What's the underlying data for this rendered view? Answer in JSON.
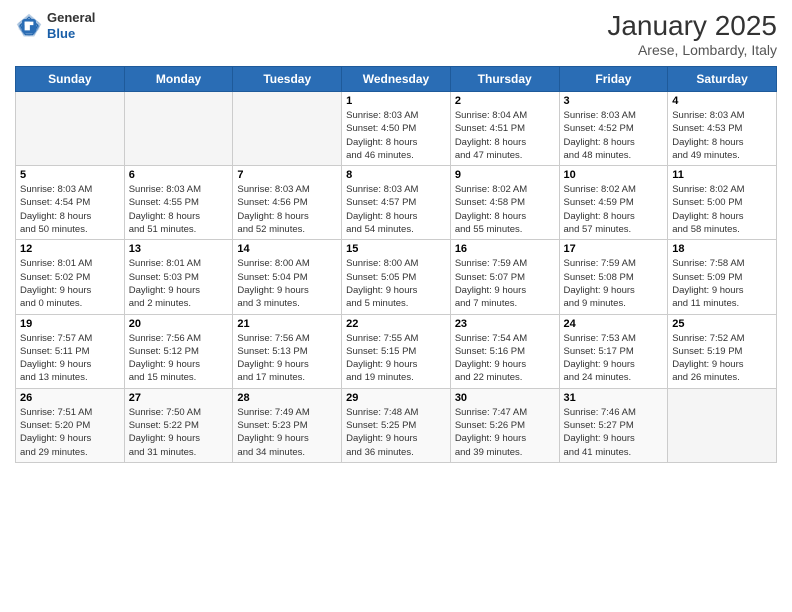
{
  "header": {
    "logo_general": "General",
    "logo_blue": "Blue",
    "month_title": "January 2025",
    "location": "Arese, Lombardy, Italy"
  },
  "weekdays": [
    "Sunday",
    "Monday",
    "Tuesday",
    "Wednesday",
    "Thursday",
    "Friday",
    "Saturday"
  ],
  "weeks": [
    [
      {
        "day": "",
        "info": ""
      },
      {
        "day": "",
        "info": ""
      },
      {
        "day": "",
        "info": ""
      },
      {
        "day": "1",
        "info": "Sunrise: 8:03 AM\nSunset: 4:50 PM\nDaylight: 8 hours\nand 46 minutes."
      },
      {
        "day": "2",
        "info": "Sunrise: 8:04 AM\nSunset: 4:51 PM\nDaylight: 8 hours\nand 47 minutes."
      },
      {
        "day": "3",
        "info": "Sunrise: 8:03 AM\nSunset: 4:52 PM\nDaylight: 8 hours\nand 48 minutes."
      },
      {
        "day": "4",
        "info": "Sunrise: 8:03 AM\nSunset: 4:53 PM\nDaylight: 8 hours\nand 49 minutes."
      }
    ],
    [
      {
        "day": "5",
        "info": "Sunrise: 8:03 AM\nSunset: 4:54 PM\nDaylight: 8 hours\nand 50 minutes."
      },
      {
        "day": "6",
        "info": "Sunrise: 8:03 AM\nSunset: 4:55 PM\nDaylight: 8 hours\nand 51 minutes."
      },
      {
        "day": "7",
        "info": "Sunrise: 8:03 AM\nSunset: 4:56 PM\nDaylight: 8 hours\nand 52 minutes."
      },
      {
        "day": "8",
        "info": "Sunrise: 8:03 AM\nSunset: 4:57 PM\nDaylight: 8 hours\nand 54 minutes."
      },
      {
        "day": "9",
        "info": "Sunrise: 8:02 AM\nSunset: 4:58 PM\nDaylight: 8 hours\nand 55 minutes."
      },
      {
        "day": "10",
        "info": "Sunrise: 8:02 AM\nSunset: 4:59 PM\nDaylight: 8 hours\nand 57 minutes."
      },
      {
        "day": "11",
        "info": "Sunrise: 8:02 AM\nSunset: 5:00 PM\nDaylight: 8 hours\nand 58 minutes."
      }
    ],
    [
      {
        "day": "12",
        "info": "Sunrise: 8:01 AM\nSunset: 5:02 PM\nDaylight: 9 hours\nand 0 minutes."
      },
      {
        "day": "13",
        "info": "Sunrise: 8:01 AM\nSunset: 5:03 PM\nDaylight: 9 hours\nand 2 minutes."
      },
      {
        "day": "14",
        "info": "Sunrise: 8:00 AM\nSunset: 5:04 PM\nDaylight: 9 hours\nand 3 minutes."
      },
      {
        "day": "15",
        "info": "Sunrise: 8:00 AM\nSunset: 5:05 PM\nDaylight: 9 hours\nand 5 minutes."
      },
      {
        "day": "16",
        "info": "Sunrise: 7:59 AM\nSunset: 5:07 PM\nDaylight: 9 hours\nand 7 minutes."
      },
      {
        "day": "17",
        "info": "Sunrise: 7:59 AM\nSunset: 5:08 PM\nDaylight: 9 hours\nand 9 minutes."
      },
      {
        "day": "18",
        "info": "Sunrise: 7:58 AM\nSunset: 5:09 PM\nDaylight: 9 hours\nand 11 minutes."
      }
    ],
    [
      {
        "day": "19",
        "info": "Sunrise: 7:57 AM\nSunset: 5:11 PM\nDaylight: 9 hours\nand 13 minutes."
      },
      {
        "day": "20",
        "info": "Sunrise: 7:56 AM\nSunset: 5:12 PM\nDaylight: 9 hours\nand 15 minutes."
      },
      {
        "day": "21",
        "info": "Sunrise: 7:56 AM\nSunset: 5:13 PM\nDaylight: 9 hours\nand 17 minutes."
      },
      {
        "day": "22",
        "info": "Sunrise: 7:55 AM\nSunset: 5:15 PM\nDaylight: 9 hours\nand 19 minutes."
      },
      {
        "day": "23",
        "info": "Sunrise: 7:54 AM\nSunset: 5:16 PM\nDaylight: 9 hours\nand 22 minutes."
      },
      {
        "day": "24",
        "info": "Sunrise: 7:53 AM\nSunset: 5:17 PM\nDaylight: 9 hours\nand 24 minutes."
      },
      {
        "day": "25",
        "info": "Sunrise: 7:52 AM\nSunset: 5:19 PM\nDaylight: 9 hours\nand 26 minutes."
      }
    ],
    [
      {
        "day": "26",
        "info": "Sunrise: 7:51 AM\nSunset: 5:20 PM\nDaylight: 9 hours\nand 29 minutes."
      },
      {
        "day": "27",
        "info": "Sunrise: 7:50 AM\nSunset: 5:22 PM\nDaylight: 9 hours\nand 31 minutes."
      },
      {
        "day": "28",
        "info": "Sunrise: 7:49 AM\nSunset: 5:23 PM\nDaylight: 9 hours\nand 34 minutes."
      },
      {
        "day": "29",
        "info": "Sunrise: 7:48 AM\nSunset: 5:25 PM\nDaylight: 9 hours\nand 36 minutes."
      },
      {
        "day": "30",
        "info": "Sunrise: 7:47 AM\nSunset: 5:26 PM\nDaylight: 9 hours\nand 39 minutes."
      },
      {
        "day": "31",
        "info": "Sunrise: 7:46 AM\nSunset: 5:27 PM\nDaylight: 9 hours\nand 41 minutes."
      },
      {
        "day": "",
        "info": ""
      }
    ]
  ]
}
